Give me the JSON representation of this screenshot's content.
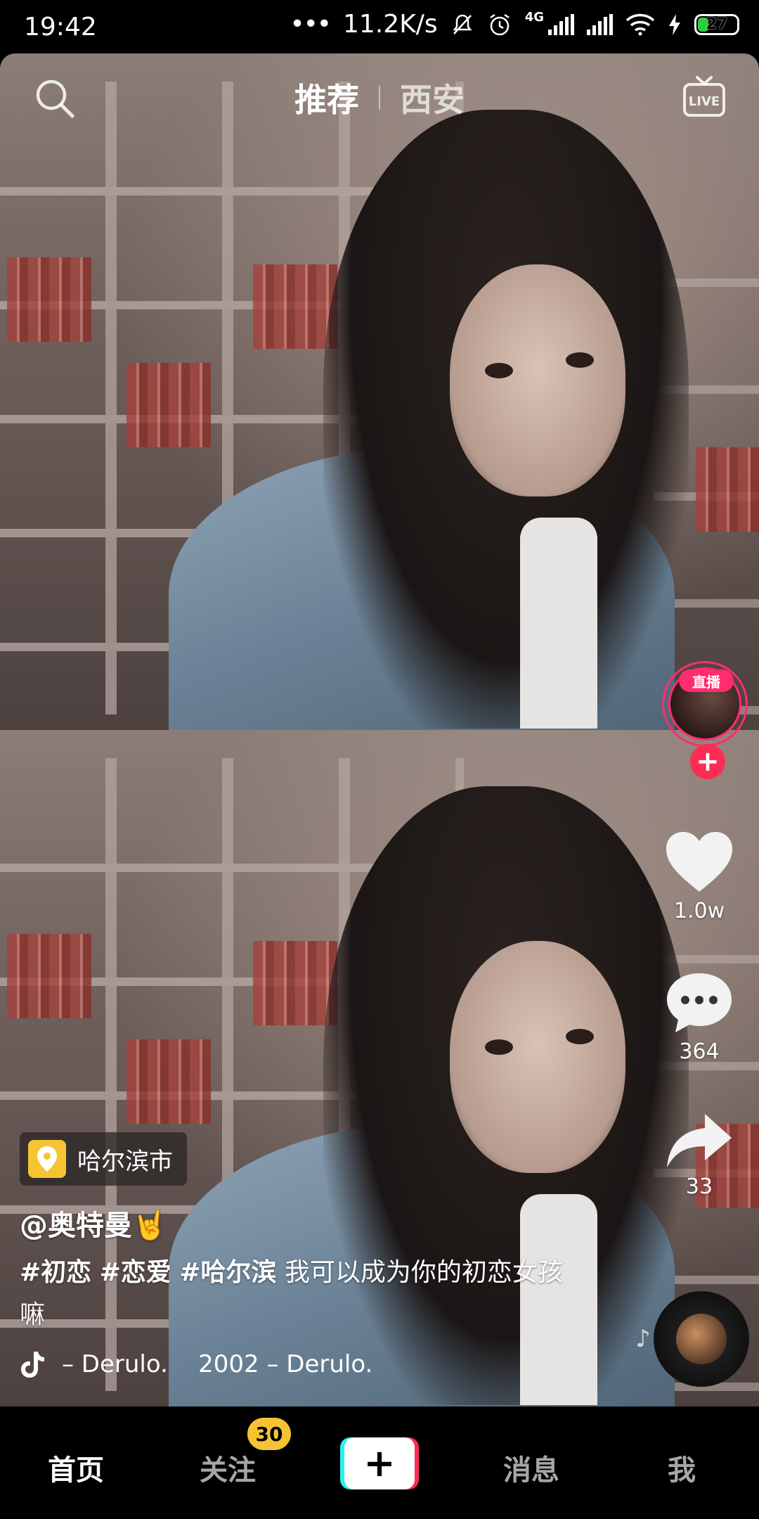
{
  "status_bar": {
    "time": "19:42",
    "network_speed": "11.2K/s",
    "network_type": "4G",
    "battery": "27",
    "icons": [
      "mute-icon",
      "alarm-icon",
      "signal-icon",
      "wifi-icon",
      "charging-icon"
    ]
  },
  "top_nav": {
    "tabs": [
      {
        "label": "推荐",
        "active": true
      },
      {
        "label": "西安",
        "active": false
      }
    ],
    "live_label": "LIVE"
  },
  "rail": {
    "live_badge": "直播",
    "follow_symbol": "+",
    "like_count": "1.0w",
    "comment_count": "364",
    "share_count": "33"
  },
  "video_info": {
    "location": "哈尔滨市",
    "author": "@奥特曼🤘",
    "hashtags": [
      "#初恋",
      "#恋爱",
      "#哈尔滨"
    ],
    "caption_text": "我可以成为你的初恋女孩嘛",
    "music": "– Derulo.    2002 – Derulo."
  },
  "bottom_nav": {
    "home": "首页",
    "follow": "关注",
    "follow_badge": "30",
    "create": "+",
    "messages": "消息",
    "me": "我"
  },
  "colors": {
    "accent": "#fe2c55",
    "cyan": "#25f4ee",
    "badge": "#f6c432"
  }
}
